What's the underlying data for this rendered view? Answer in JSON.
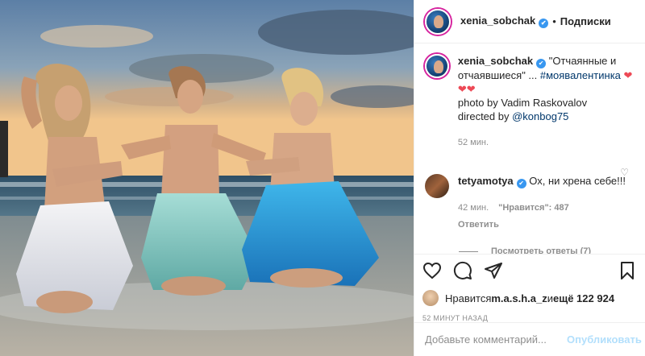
{
  "post": {
    "author": "xenia_sobchak",
    "follow_label": "Подписки",
    "dot": "•"
  },
  "caption": {
    "user": "xenia_sobchak",
    "text_part1": "\"Отчаянные и отчаявшиеся\" ... ",
    "hashtag": "#моявалентинка",
    "hearts1": "❤",
    "hearts2": "❤❤",
    "credit1": "photo by Vadim Raskovalov",
    "credit2_prefix": "directed by ",
    "credit2_mention": "@konbog75",
    "time": "52 мин."
  },
  "comment": {
    "user": "tetyamotya",
    "text": "Ох, ни хрена себе!!!",
    "time": "42 мин.",
    "likes": "\"Нравится\": 487",
    "reply": "Ответить",
    "view_replies": "Посмотреть ответы (7)"
  },
  "likes": {
    "prefix": "Нравится ",
    "user": "m.a.s.h.a_z",
    "suffix": " и ",
    "count": "ещё 122 924"
  },
  "timestamp": "52 МИНУТ НАЗАД",
  "add_comment": {
    "placeholder": "Добавьте комментарий...",
    "publish": "Опубликовать"
  },
  "colors": {
    "accent": "#3897f0",
    "heart": "#ed4956",
    "muted": "#8e8e8e"
  }
}
